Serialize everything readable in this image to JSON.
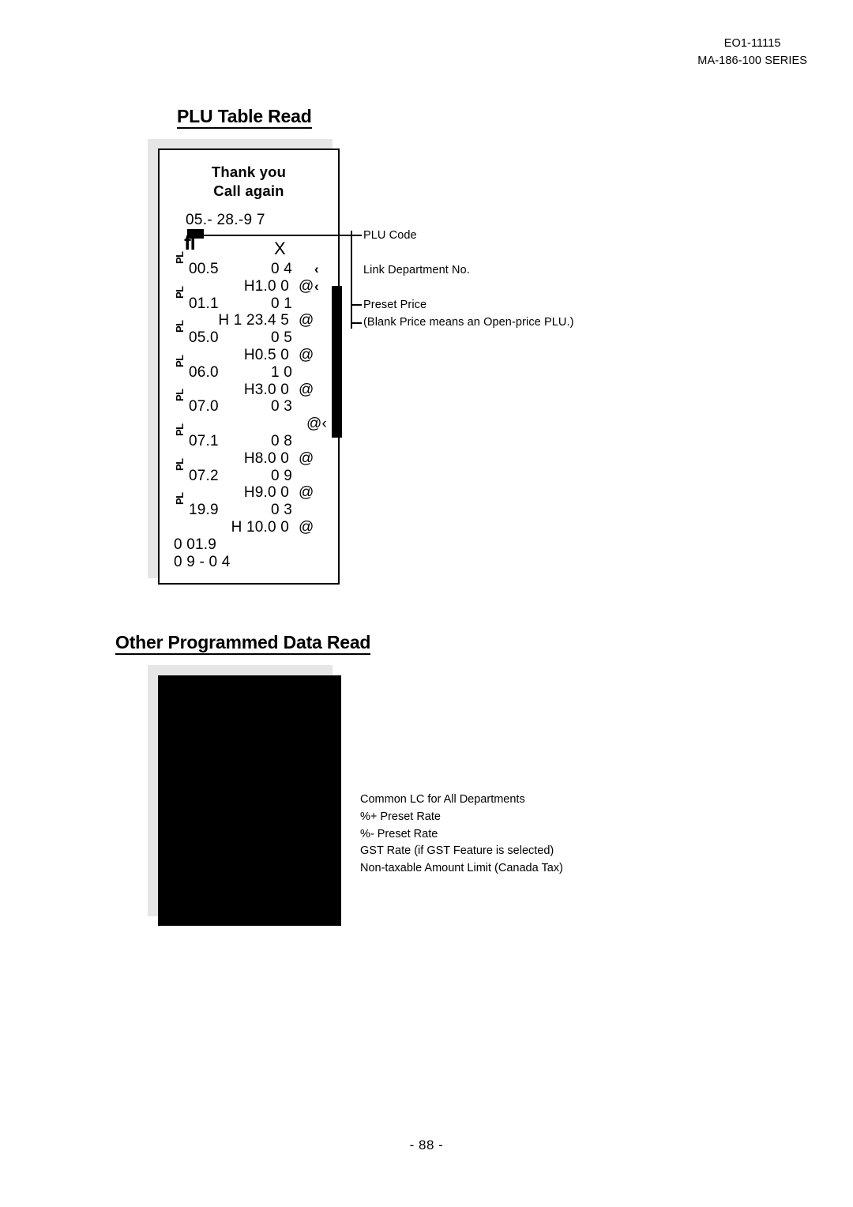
{
  "document": {
    "header_code": "EO1-11115",
    "header_series": "MA-186-100 SERIES",
    "page_number": "- 88 -"
  },
  "sections": {
    "plu_table_read": {
      "title": "PLU Table Read",
      "receipt": {
        "header_line_1": "Thank you",
        "header_line_2": "Call again",
        "date_line": "05.- 28.-9 7",
        "artifact_text": "fl",
        "mode_symbol": "X",
        "rows": [
          {
            "pl": "PL",
            "code": "00.5",
            "dept": "0 4",
            "arrow": "‹"
          },
          {
            "price": "H1.0 0",
            "at": "@",
            "arrow": "‹"
          },
          {
            "pl": "PL",
            "code": "01.1",
            "dept": "0 1"
          },
          {
            "price": "H 1 23.4 5",
            "at": "@"
          },
          {
            "pl": "PL",
            "code": "05.0",
            "dept": "0 5"
          },
          {
            "price": "H0.5 0",
            "at": "@"
          },
          {
            "pl": "PL",
            "code": "06.0",
            "dept": "1 0"
          },
          {
            "price": "H3.0 0",
            "at": "@"
          },
          {
            "pl": "PL",
            "code": "07.0",
            "dept": "0 3"
          },
          {
            "at_arrow": "@‹"
          },
          {
            "pl": "PL",
            "code": "07.1",
            "dept": "0 8"
          },
          {
            "price": "H8.0 0",
            "at": "@"
          },
          {
            "pl": "PL",
            "code": "07.2",
            "dept": "0 9"
          },
          {
            "price": "H9.0 0",
            "at": "@"
          },
          {
            "pl": "PL",
            "code": "19.9",
            "dept": "0 3"
          },
          {
            "price": "H 10.0 0",
            "at": "@"
          },
          {
            "free": "0 01.9"
          },
          {
            "free": "0 9 - 0 4"
          }
        ]
      },
      "annotations": [
        "PLU Code",
        "Link Department No.",
        "Preset Price",
        "(Blank Price means an Open-price PLU.)"
      ]
    },
    "other_programmed_data_read": {
      "title": "Other Programmed Data Read",
      "annotations": [
        "Common LC for All Departments",
        "%+ Preset Rate",
        "%- Preset Rate",
        "GST Rate (if GST Feature is selected)",
        "Non-taxable Amount Limit (Canada Tax)"
      ]
    }
  }
}
